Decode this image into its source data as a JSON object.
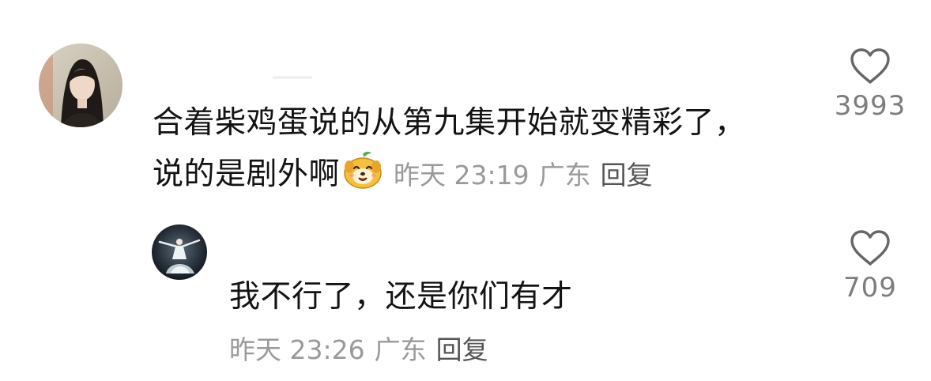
{
  "comments": [
    {
      "avatar_icon": "user-avatar-woman-portrait",
      "text_lines": [
        "合着柴鸡蛋说的从第九集开始就变精彩了，",
        "说的是剧外啊"
      ],
      "emoji_icon": "smiling-dog-emoji",
      "time": "昨天 23:19",
      "location": "广东",
      "reply_label": "回复",
      "likes": "3993"
    },
    {
      "avatar_icon": "user-avatar-dancer",
      "text": "我不行了，还是你们有才",
      "time": "昨天 23:26",
      "location": "广东",
      "reply_label": "回复",
      "likes": "709"
    }
  ],
  "colors": {
    "text": "#131313",
    "meta": "#9a9a9a",
    "reply": "#555555",
    "like_count": "#7d7d7d",
    "heart_outline": "#666666"
  }
}
